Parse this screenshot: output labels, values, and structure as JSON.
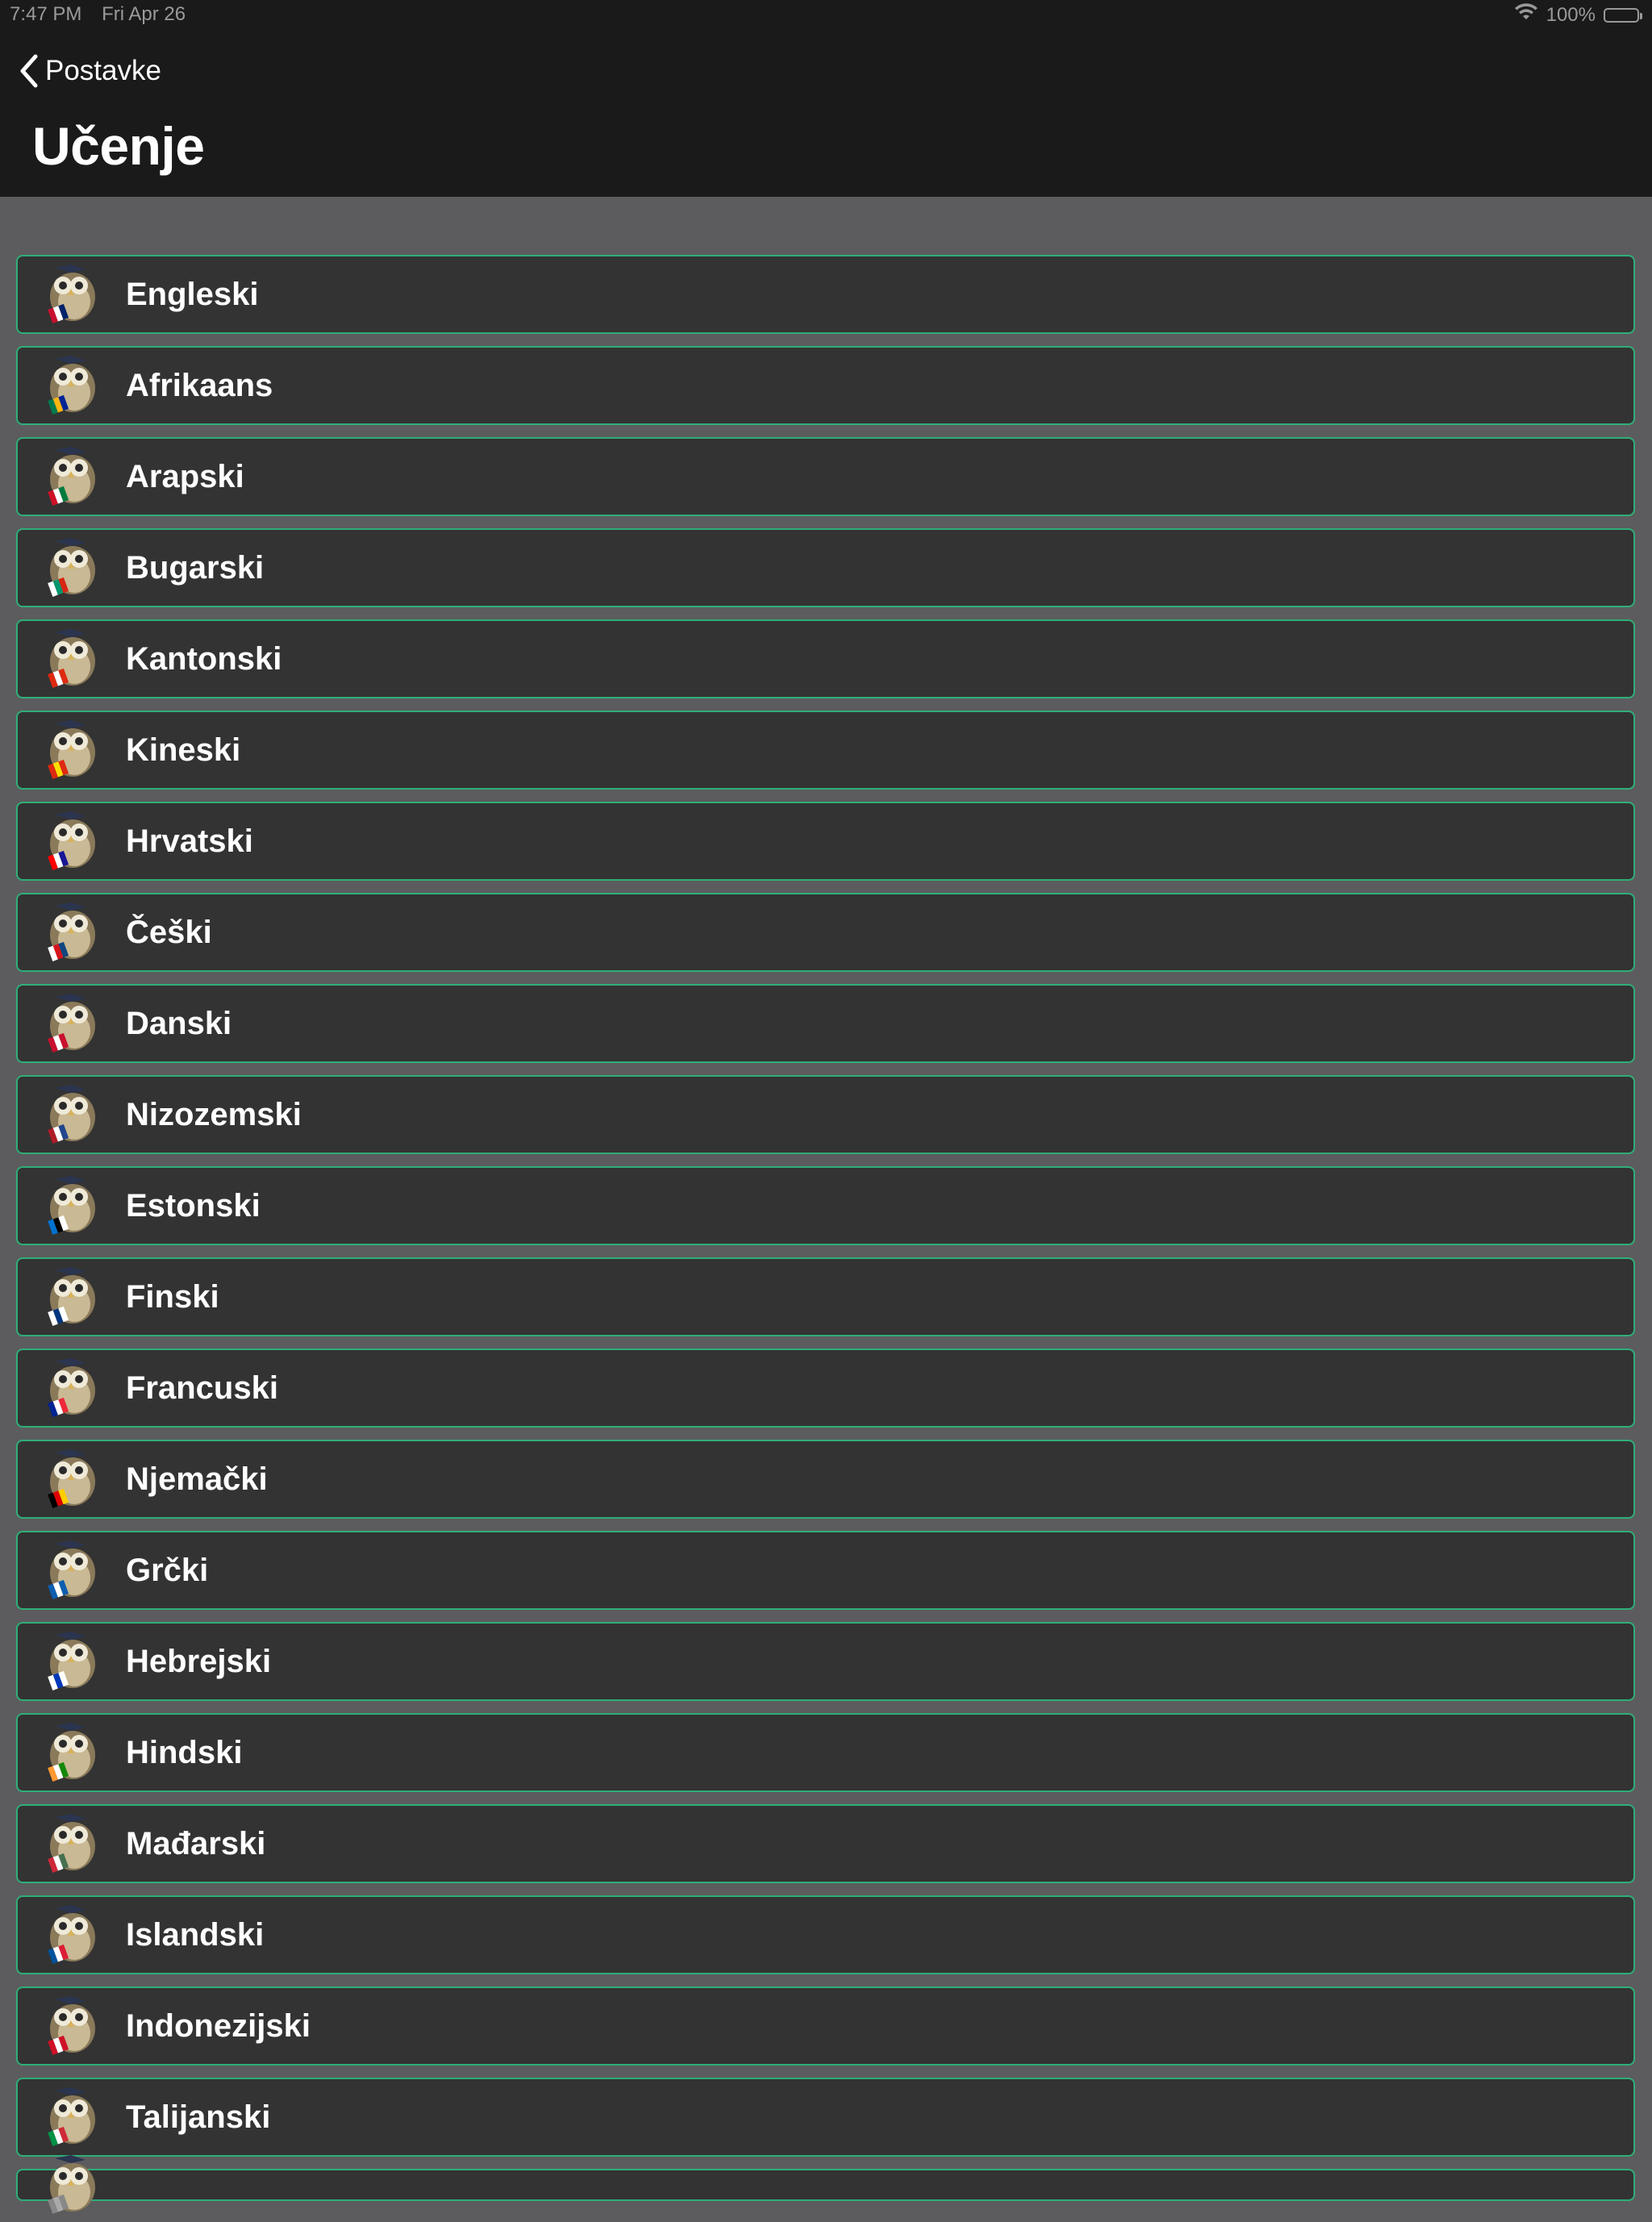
{
  "status_bar": {
    "time": "7:47 PM",
    "date": "Fri Apr 26",
    "battery": "100%",
    "battery_level": 1.0,
    "icons": [
      "wifi-icon",
      "battery-icon"
    ]
  },
  "nav": {
    "back_label": "Postavke",
    "title": "Učenje"
  },
  "colors": {
    "header_bg": "#1a1a1a",
    "page_bg": "#5c5c5e",
    "row_bg": "#333333",
    "row_border": "#2fae78",
    "text": "#ffffff"
  },
  "languages": [
    {
      "label": "Engleski",
      "icon": "owl-flag-uk-icon",
      "flag_colors": [
        "#c8102e",
        "#ffffff",
        "#012169"
      ]
    },
    {
      "label": "Afrikaans",
      "icon": "owl-flag-south-africa-icon",
      "flag_colors": [
        "#007a4d",
        "#ffb612",
        "#002395"
      ]
    },
    {
      "label": "Arapski",
      "icon": "owl-flag-arabic-icon",
      "flag_colors": [
        "#ce1126",
        "#ffffff",
        "#007a3d"
      ]
    },
    {
      "label": "Bugarski",
      "icon": "owl-flag-bulgaria-icon",
      "flag_colors": [
        "#ffffff",
        "#00966e",
        "#d62612"
      ]
    },
    {
      "label": "Kantonski",
      "icon": "owl-flag-hong-kong-icon",
      "flag_colors": [
        "#de2910",
        "#ffffff",
        "#de2910"
      ]
    },
    {
      "label": "Kineski",
      "icon": "owl-flag-china-icon",
      "flag_colors": [
        "#de2910",
        "#ffde00",
        "#de2910"
      ]
    },
    {
      "label": "Hrvatski",
      "icon": "owl-flag-croatia-icon",
      "flag_colors": [
        "#ff0000",
        "#ffffff",
        "#171796"
      ]
    },
    {
      "label": "Češki",
      "icon": "owl-flag-czech-icon",
      "flag_colors": [
        "#ffffff",
        "#d7141a",
        "#11457e"
      ]
    },
    {
      "label": "Danski",
      "icon": "owl-flag-denmark-icon",
      "flag_colors": [
        "#c8102e",
        "#ffffff",
        "#c8102e"
      ]
    },
    {
      "label": "Nizozemski",
      "icon": "owl-flag-netherlands-icon",
      "flag_colors": [
        "#ae1c28",
        "#ffffff",
        "#21468b"
      ]
    },
    {
      "label": "Estonski",
      "icon": "owl-flag-estonia-icon",
      "flag_colors": [
        "#0072ce",
        "#000000",
        "#ffffff"
      ]
    },
    {
      "label": "Finski",
      "icon": "owl-flag-finland-icon",
      "flag_colors": [
        "#ffffff",
        "#003580",
        "#ffffff"
      ]
    },
    {
      "label": "Francuski",
      "icon": "owl-flag-france-icon",
      "flag_colors": [
        "#002395",
        "#ffffff",
        "#ed2939"
      ]
    },
    {
      "label": "Njemački",
      "icon": "owl-flag-germany-icon",
      "flag_colors": [
        "#000000",
        "#dd0000",
        "#ffce00"
      ]
    },
    {
      "label": "Grčki",
      "icon": "owl-flag-greece-icon",
      "flag_colors": [
        "#0d5eaf",
        "#ffffff",
        "#0d5eaf"
      ]
    },
    {
      "label": "Hebrejski",
      "icon": "owl-flag-israel-icon",
      "flag_colors": [
        "#ffffff",
        "#0038b8",
        "#ffffff"
      ]
    },
    {
      "label": "Hindski",
      "icon": "owl-flag-india-icon",
      "flag_colors": [
        "#ff9933",
        "#ffffff",
        "#138808"
      ]
    },
    {
      "label": "Mađarski",
      "icon": "owl-flag-hungary-icon",
      "flag_colors": [
        "#ce2939",
        "#ffffff",
        "#477050"
      ]
    },
    {
      "label": "Islandski",
      "icon": "owl-flag-iceland-icon",
      "flag_colors": [
        "#02529c",
        "#ffffff",
        "#dc1e35"
      ]
    },
    {
      "label": "Indonezijski",
      "icon": "owl-flag-indonesia-icon",
      "flag_colors": [
        "#ce1126",
        "#ffffff",
        "#ce1126"
      ]
    },
    {
      "label": "Talijanski",
      "icon": "owl-flag-italy-icon",
      "flag_colors": [
        "#009246",
        "#ffffff",
        "#ce2b37"
      ]
    },
    {
      "label": "",
      "icon": "owl-icon",
      "flag_colors": [
        "#888888",
        "#aaaaaa",
        "#888888"
      ]
    }
  ]
}
